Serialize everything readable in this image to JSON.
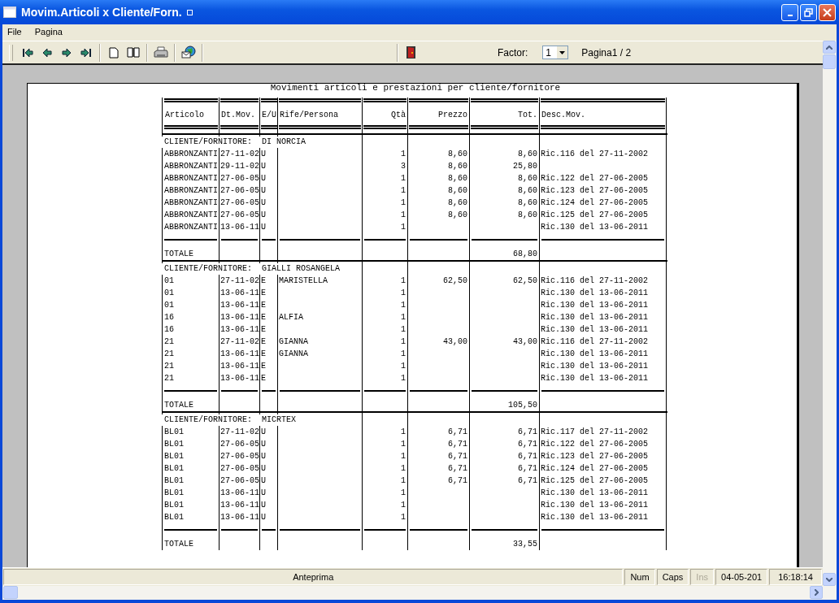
{
  "window": {
    "title": "Movim.Articoli x Cliente/Forn."
  },
  "menu": [
    "File",
    "Pagina"
  ],
  "toolbar": {
    "factor_label": "Factor:",
    "factor_value": "1",
    "page_label": "Pagina1 / 2"
  },
  "report": {
    "title": "Movimenti articoli e prestazioni per cliente/fornitore",
    "columns": [
      "Articolo",
      "Dt.Mov.",
      "E/U",
      "Rife/Persona",
      "Qtà",
      "Prezzo",
      "Tot.",
      "Desc.Mov."
    ],
    "groups": [
      {
        "label": "CLIENTE/FORNITORE:  DI NORCIA",
        "total_label": "TOTALE",
        "total": "68,80",
        "rows": [
          {
            "articolo": "ABBRONZANTI",
            "dt_mov": "27-11-02",
            "e_u": "U",
            "qta": "1",
            "prezzo": "8,60",
            "tot": "8,60",
            "desc": "Ric.116 del 27-11-2002"
          },
          {
            "articolo": "ABBRONZANTI",
            "dt_mov": "29-11-02",
            "e_u": "U",
            "qta": "3",
            "prezzo": "8,60",
            "tot": "25,80"
          },
          {
            "articolo": "ABBRONZANTI",
            "dt_mov": "27-06-05",
            "e_u": "U",
            "qta": "1",
            "prezzo": "8,60",
            "tot": "8,60",
            "desc": "Ric.122 del 27-06-2005"
          },
          {
            "articolo": "ABBRONZANTI",
            "dt_mov": "27-06-05",
            "e_u": "U",
            "qta": "1",
            "prezzo": "8,60",
            "tot": "8,60",
            "desc": "Ric.123 del 27-06-2005"
          },
          {
            "articolo": "ABBRONZANTI",
            "dt_mov": "27-06-05",
            "e_u": "U",
            "qta": "1",
            "prezzo": "8,60",
            "tot": "8,60",
            "desc": "Ric.124 del 27-06-2005"
          },
          {
            "articolo": "ABBRONZANTI",
            "dt_mov": "27-06-05",
            "e_u": "U",
            "qta": "1",
            "prezzo": "8,60",
            "tot": "8,60",
            "desc": "Ric.125 del 27-06-2005"
          },
          {
            "articolo": "ABBRONZANTI",
            "dt_mov": "13-06-11",
            "e_u": "U",
            "qta": "1",
            "desc": "Ric.130 del 13-06-2011"
          }
        ]
      },
      {
        "label": "CLIENTE/FORNITORE:  GIALLI ROSANGELA",
        "total_label": "TOTALE",
        "total": "105,50",
        "rows": [
          {
            "articolo": "01",
            "dt_mov": "27-11-02",
            "e_u": "E",
            "rife": "MARISTELLA",
            "qta": "1",
            "prezzo": "62,50",
            "tot": "62,50",
            "desc": "Ric.116 del 27-11-2002"
          },
          {
            "articolo": "01",
            "dt_mov": "13-06-11",
            "e_u": "E",
            "qta": "1",
            "desc": "Ric.130 del 13-06-2011"
          },
          {
            "articolo": "01",
            "dt_mov": "13-06-11",
            "e_u": "E",
            "qta": "1",
            "desc": "Ric.130 del 13-06-2011"
          },
          {
            "articolo": "16",
            "dt_mov": "13-06-11",
            "e_u": "E",
            "rife": "ALFIA",
            "qta": "1",
            "desc": "Ric.130 del 13-06-2011"
          },
          {
            "articolo": "16",
            "dt_mov": "13-06-11",
            "e_u": "E",
            "qta": "1",
            "desc": "Ric.130 del 13-06-2011"
          },
          {
            "articolo": "21",
            "dt_mov": "27-11-02",
            "e_u": "E",
            "rife": "GIANNA",
            "qta": "1",
            "prezzo": "43,00",
            "tot": "43,00",
            "desc": "Ric.116 del 27-11-2002"
          },
          {
            "articolo": "21",
            "dt_mov": "13-06-11",
            "e_u": "E",
            "rife": "GIANNA",
            "qta": "1",
            "desc": "Ric.130 del 13-06-2011"
          },
          {
            "articolo": "21",
            "dt_mov": "13-06-11",
            "e_u": "E",
            "qta": "1",
            "desc": "Ric.130 del 13-06-2011"
          },
          {
            "articolo": "21",
            "dt_mov": "13-06-11",
            "e_u": "E",
            "qta": "1",
            "desc": "Ric.130 del 13-06-2011"
          }
        ]
      },
      {
        "label": "CLIENTE/FORNITORE:  MICRTEX",
        "total_label": "TOTALE",
        "total": "33,55",
        "rows": [
          {
            "articolo": "BL01",
            "dt_mov": "27-11-02",
            "e_u": "U",
            "qta": "1",
            "prezzo": "6,71",
            "tot": "6,71",
            "desc": "Ric.117 del 27-11-2002"
          },
          {
            "articolo": "BL01",
            "dt_mov": "27-06-05",
            "e_u": "U",
            "qta": "1",
            "prezzo": "6,71",
            "tot": "6,71",
            "desc": "Ric.122 del 27-06-2005"
          },
          {
            "articolo": "BL01",
            "dt_mov": "27-06-05",
            "e_u": "U",
            "qta": "1",
            "prezzo": "6,71",
            "tot": "6,71",
            "desc": "Ric.123 del 27-06-2005"
          },
          {
            "articolo": "BL01",
            "dt_mov": "27-06-05",
            "e_u": "U",
            "qta": "1",
            "prezzo": "6,71",
            "tot": "6,71",
            "desc": "Ric.124 del 27-06-2005"
          },
          {
            "articolo": "BL01",
            "dt_mov": "27-06-05",
            "e_u": "U",
            "qta": "1",
            "prezzo": "6,71",
            "tot": "6,71",
            "desc": "Ric.125 del 27-06-2005"
          },
          {
            "articolo": "BL01",
            "dt_mov": "13-06-11",
            "e_u": "U",
            "qta": "1",
            "desc": "Ric.130 del 13-06-2011"
          },
          {
            "articolo": "BL01",
            "dt_mov": "13-06-11",
            "e_u": "U",
            "qta": "1",
            "desc": "Ric.130 del 13-06-2011"
          },
          {
            "articolo": "BL01",
            "dt_mov": "13-06-11",
            "e_u": "U",
            "qta": "1",
            "desc": "Ric.130 del 13-06-2011"
          }
        ]
      }
    ]
  },
  "status_bar": {
    "message": "Anteprima",
    "indicators": [
      {
        "label": "Num",
        "disabled": false
      },
      {
        "label": "Caps",
        "disabled": false
      },
      {
        "label": "Ins",
        "disabled": true
      }
    ],
    "date": "04-05-201",
    "time": "16:18:14"
  }
}
